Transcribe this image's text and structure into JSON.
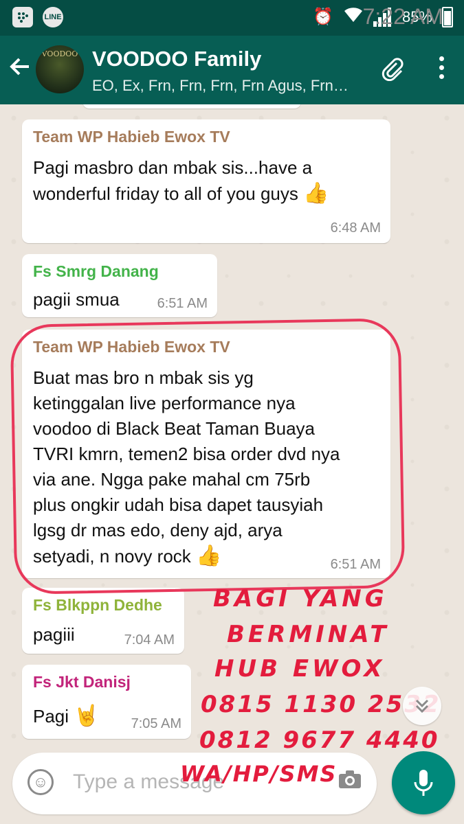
{
  "status_bar": {
    "left_icons": [
      "bbm-icon",
      "line-icon"
    ],
    "line_label": "LINE",
    "battery": "85%",
    "time": "7:22 AM"
  },
  "header": {
    "group_name": "VOODOO Family",
    "members": "EO, Ex, Frn, Frn, Frn, Frn Agus, Frn…",
    "avatar_label": "VOODOO"
  },
  "messages": [
    {
      "sender": "Team WP Habieb Ewox TV",
      "sender_color": "#a67c5b",
      "text": "Pagi masbro dan mbak sis...have a\nwonderful friday to all of you guys",
      "emoji": "👍",
      "time": "6:48 AM"
    },
    {
      "sender": "Fs Smrg Danang",
      "sender_color": "#43b34a",
      "text": "pagii smua",
      "time": "6:51 AM"
    },
    {
      "sender": "Team WP Habieb Ewox TV",
      "sender_color": "#a67c5b",
      "text": "Buat mas bro n mbak sis yg\nketinggalan live performance nya\nvoodoo di Black Beat Taman Buaya\nTVRI kmrn, temen2 bisa order dvd nya\nvia ane. Ngga pake mahal cm 75rb\nplus ongkir udah bisa dapet tausyiah\nlgsg dr mas edo, deny ajd, arya\nsetyadi, n novy rock",
      "emoji": "👍",
      "time": "6:51 AM"
    },
    {
      "sender": "Fs Blkppn Dedhe",
      "sender_color": "#8fb33a",
      "text": "pagiii",
      "time": "7:04 AM"
    },
    {
      "sender": "Fs Jkt Danisj",
      "sender_color": "#c2247a",
      "text": "Pagi",
      "emoji": "🤘",
      "time": "7:05 AM"
    }
  ],
  "annotation": {
    "lines": [
      "BAGI YANG",
      "BERMINAT",
      "HUB EWOX",
      "0815 1130 2532",
      "0812 9677 4440",
      "WA/HP/SMS"
    ]
  },
  "input": {
    "placeholder": "Type a message"
  },
  "colors": {
    "status_bar": "#054d44",
    "app_bar": "#075e54",
    "mic_button": "#00897b",
    "annotation": "#e31c3d"
  }
}
